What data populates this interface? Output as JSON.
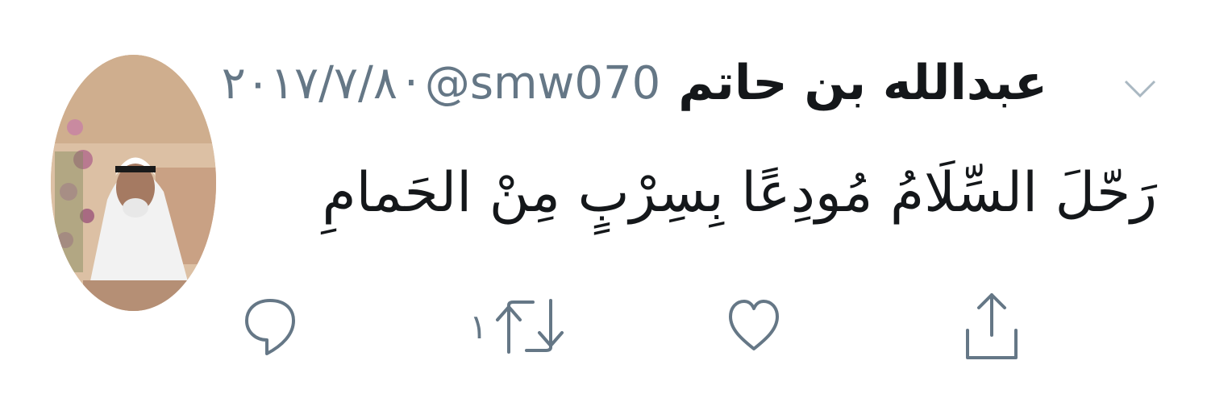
{
  "tweet": {
    "display_name": "عبدالله بن حاتم",
    "handle": "@smw070",
    "separator": "·",
    "date": "٢٠١٧/٧/٨",
    "text": "رَحّلَ السِّلَامُ مُودِعًا بِسِرْبٍ مِنْ الحَمامِ"
  },
  "actions": {
    "reply": {
      "icon": "reply-icon",
      "count": ""
    },
    "retweet": {
      "icon": "retweet-icon",
      "count": "١"
    },
    "like": {
      "icon": "heart-icon",
      "count": ""
    },
    "share": {
      "icon": "share-icon",
      "count": ""
    }
  },
  "menu": {
    "icon": "chevron-down-icon"
  },
  "colors": {
    "text": "#14171a",
    "secondary": "#657786",
    "background": "#ffffff"
  }
}
